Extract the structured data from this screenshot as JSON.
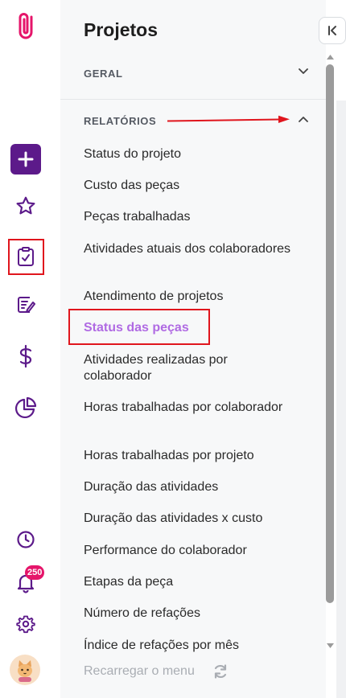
{
  "panel": {
    "title": "Projetos",
    "sections": [
      {
        "label": "GERAL",
        "expanded": false
      },
      {
        "label": "RELATÓRIOS",
        "expanded": true
      }
    ],
    "items": [
      "Status do projeto",
      "Custo das peças",
      "Peças trabalhadas",
      "Atividades atuais dos colaboradores",
      "Atendimento de projetos",
      "Status das peças",
      "Atividades realizadas por colaborador",
      "Horas trabalhadas por colaborador",
      "Horas trabalhadas por projeto",
      "Duração das atividades",
      "Duração das atividades x custo",
      "Performance do colaborador",
      "Etapas da peça",
      "Número de refações",
      "Índice de refações por mês"
    ],
    "active_item": "Status das peças",
    "reload_label": "Recarregar o menu"
  },
  "rail": {
    "logo_icon": "paperclip-icon",
    "icons": [
      "plus-icon",
      "star-icon",
      "clipboard-check-icon",
      "edit-note-icon",
      "dollar-icon",
      "pie-chart-icon",
      "clock-icon",
      "bell-icon",
      "gear-icon"
    ],
    "notifications_badge": "250"
  },
  "colors": {
    "brand_pink": "#e5156a",
    "brand_purple": "#5c1a8a",
    "active_text": "#b06ae3",
    "annotation_red": "#e0151d"
  }
}
